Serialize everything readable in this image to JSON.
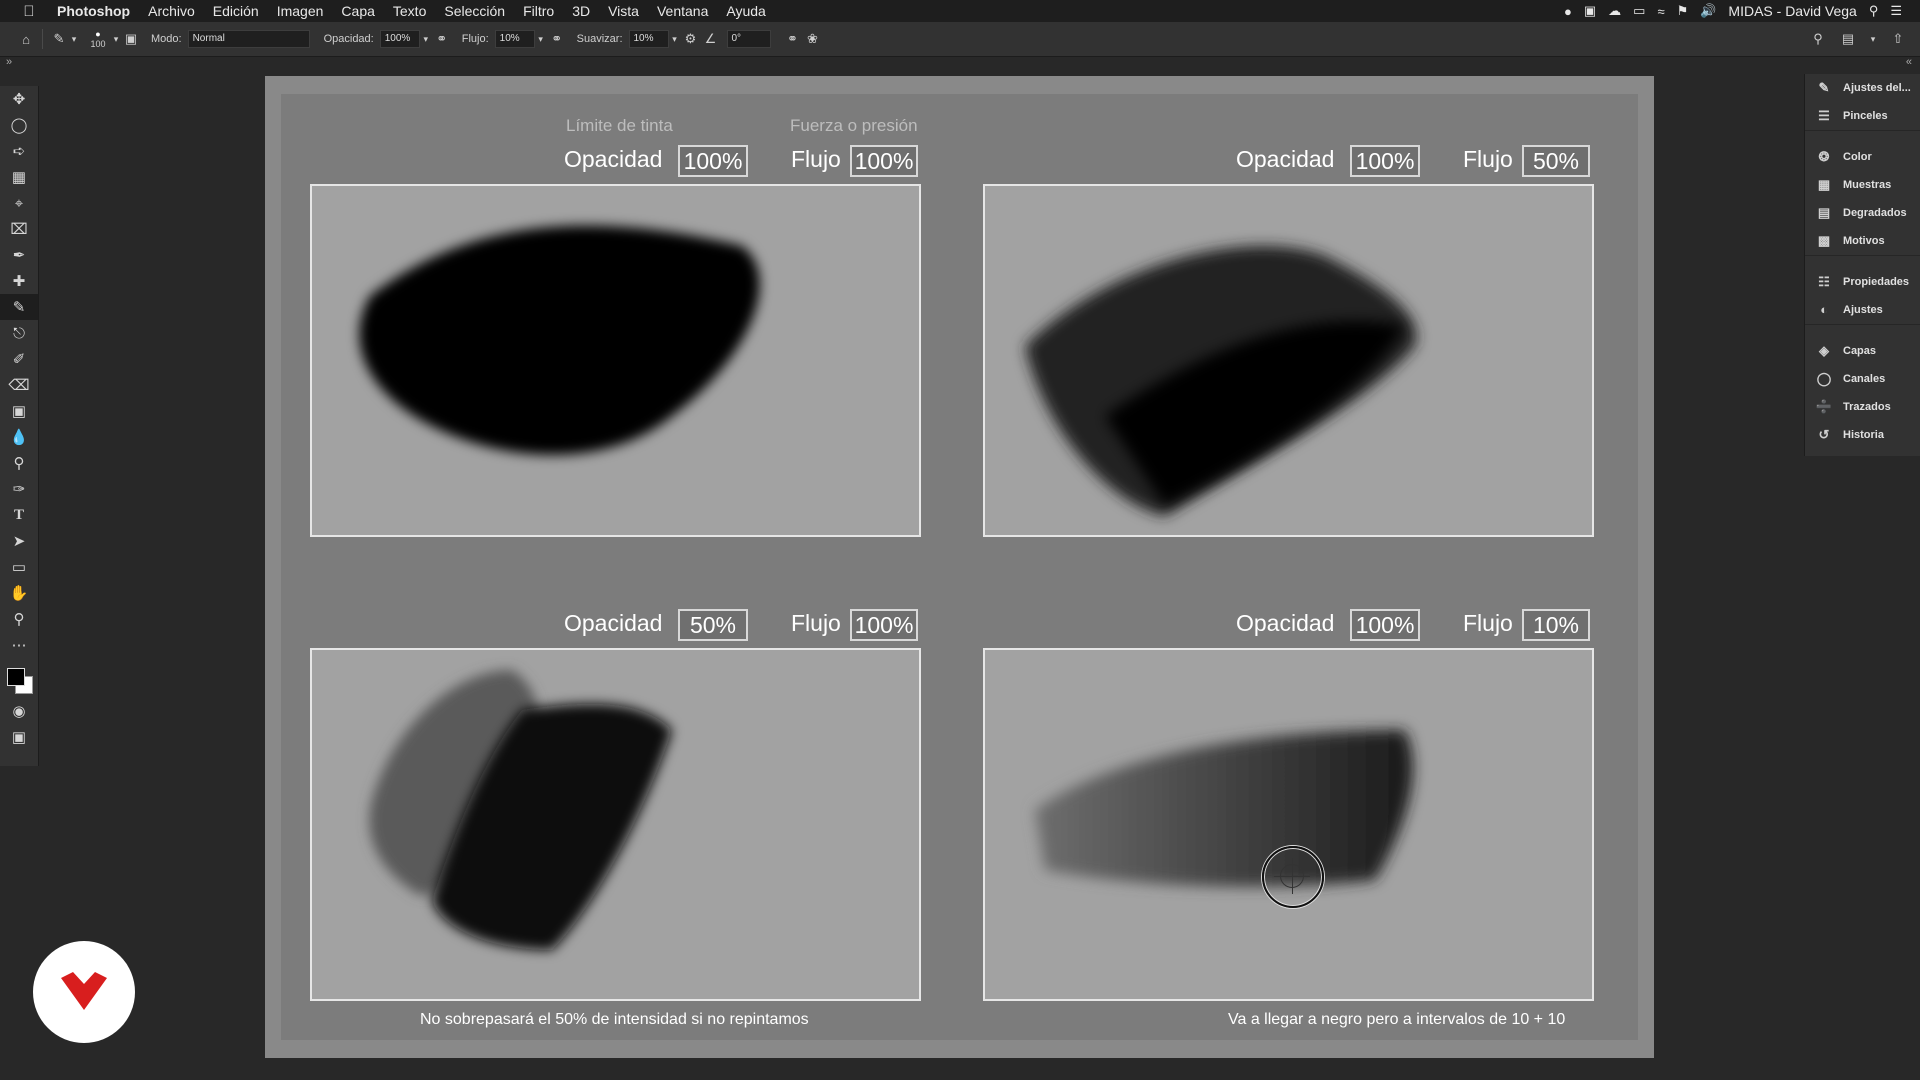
{
  "menubar": {
    "app_name": "Photoshop",
    "items": [
      "Archivo",
      "Edición",
      "Imagen",
      "Capa",
      "Texto",
      "Selección",
      "Filtro",
      "3D",
      "Vista",
      "Ventana",
      "Ayuda"
    ],
    "user": "MIDAS - David Vega"
  },
  "options_bar": {
    "brush_size": "100",
    "mode_label": "Modo:",
    "mode_value": "Normal",
    "opacity_label": "Opacidad:",
    "opacity_value": "100%",
    "flow_label": "Flujo:",
    "flow_value": "10%",
    "smoothing_label": "Suavizar:",
    "smoothing_value": "10%",
    "angle_value": "0°"
  },
  "panels": {
    "items": [
      "Ajustes del...",
      "Pinceles",
      "Color",
      "Muestras",
      "Degradados",
      "Motivos",
      "Propiedades",
      "Ajustes",
      "Capas",
      "Canales",
      "Trazados",
      "Historia"
    ]
  },
  "canvas": {
    "caption_ink": "Límite de tinta",
    "caption_pressure": "Fuerza o presión",
    "opacity_label": "Opacidad",
    "flow_label": "Flujo",
    "quadrants": [
      {
        "opacity": "100%",
        "flow": "100%"
      },
      {
        "opacity": "100%",
        "flow": "50%"
      },
      {
        "opacity": "50%",
        "flow": "100%"
      },
      {
        "opacity": "100%",
        "flow": "10%"
      }
    ],
    "note_left": "No sobrepasará el 50% de intensidad si no repintamos",
    "note_right": "Va a llegar a negro pero a intervalos de 10  + 10"
  },
  "colors": {
    "foreground": "#000000",
    "background": "#ffffff",
    "logo_red": "#d81e1e"
  }
}
